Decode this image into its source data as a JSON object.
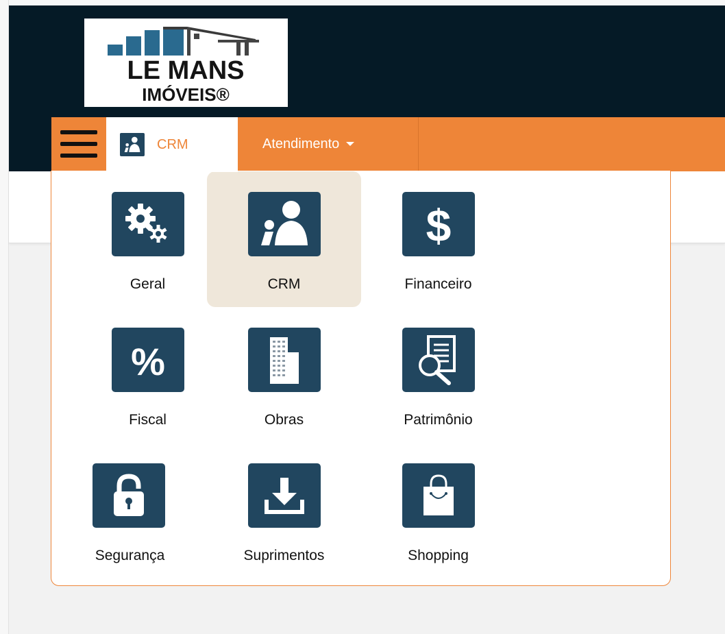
{
  "brand": {
    "line1": "LE MANS",
    "line2": "IMÓVEIS®"
  },
  "nav": {
    "menu_icon": "hamburger-icon",
    "active_tab": {
      "label": "CRM",
      "icon": "crm-people-icon"
    },
    "tabs": [
      {
        "label": "Atendimento",
        "icon": "caret-down-icon"
      }
    ]
  },
  "modules": [
    {
      "label": "Geral",
      "icon": "gears-icon",
      "selected": false
    },
    {
      "label": "CRM",
      "icon": "crm-people-icon",
      "selected": true
    },
    {
      "label": "Financeiro",
      "icon": "dollar-icon",
      "selected": false
    },
    {
      "label": "Fiscal",
      "icon": "percent-icon",
      "selected": false
    },
    {
      "label": "Obras",
      "icon": "building-icon",
      "selected": false
    },
    {
      "label": "Patrimônio",
      "icon": "document-search-icon",
      "selected": false
    },
    {
      "label": "Segurança",
      "icon": "padlock-icon",
      "selected": false
    },
    {
      "label": "Suprimentos",
      "icon": "download-icon",
      "selected": false
    },
    {
      "label": "Shopping",
      "icon": "shopping-bag-icon",
      "selected": false
    }
  ],
  "colors": {
    "topbar": "#051a26",
    "accent_orange": "#ee8538",
    "icon_navy": "#21465f",
    "selected_tile": "#efe7da",
    "logo_blue": "#2a6a8f"
  }
}
